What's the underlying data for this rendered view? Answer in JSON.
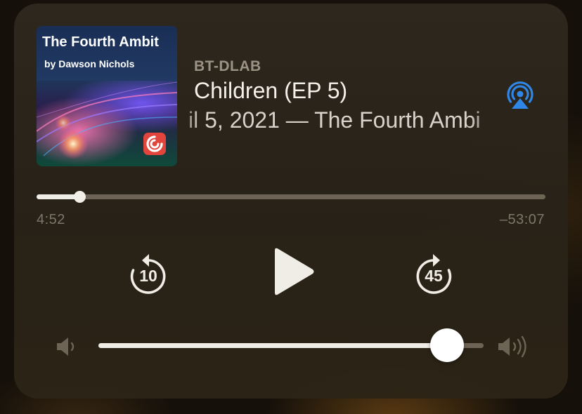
{
  "artwork": {
    "title": "The Fourth Ambit",
    "author": "by Dawson Nichols",
    "badge_icon": "pocket-casts-icon",
    "badge_color": "#e2453c"
  },
  "now_playing": {
    "podcast": "BT-DLAB",
    "episode_title": "Children (EP 5)",
    "episode_subtitle": "il 5, 2021 — The Fourth Ambi"
  },
  "airplay": {
    "icon": "airplay-icon",
    "color": "#2f86e6"
  },
  "progress": {
    "elapsed": "4:52",
    "remaining": "–53:07",
    "fraction": 0.084
  },
  "controls": {
    "skip_back": {
      "label": "10",
      "icon": "skip-back-icon"
    },
    "play": {
      "icon": "play-icon"
    },
    "skip_forward": {
      "label": "45",
      "icon": "skip-forward-icon"
    }
  },
  "volume": {
    "level": 0.905,
    "low_icon": "volume-low-icon",
    "high_icon": "volume-high-icon"
  }
}
